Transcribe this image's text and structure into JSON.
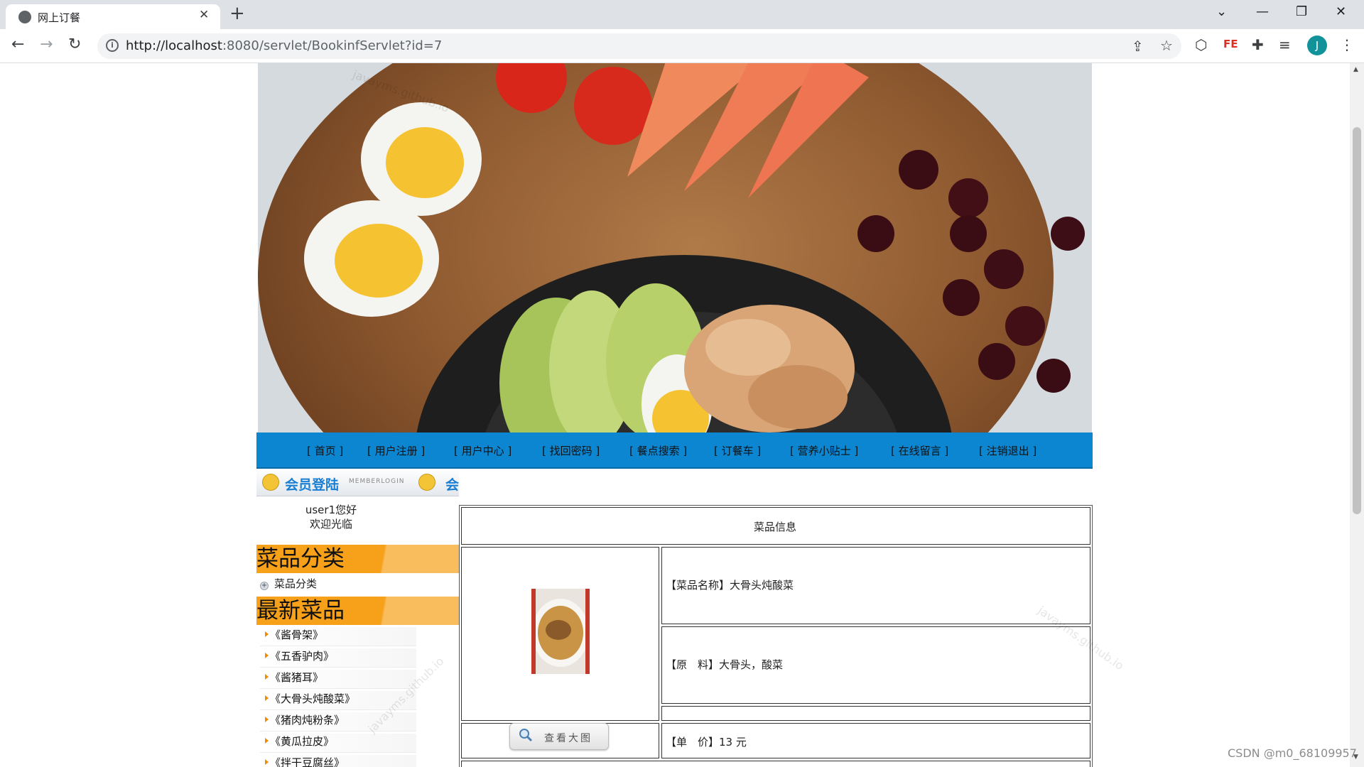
{
  "browser": {
    "tab_title": "网上订餐",
    "url_host": "http://localhost",
    "url_rest": ":8080/servlet/BookinfServlet?id=7",
    "profile_initial": "J"
  },
  "nav": {
    "items": [
      "[ 首页 ]",
      "[ 用户注册 ]",
      "[ 用户中心 ]",
      "[ 找回密码 ]",
      "[ 餐点搜索 ]",
      "[ 订餐车 ]",
      "[ 营养小贴士 ]",
      "[ 在线留言 ]",
      "[ 注销退出 ]"
    ]
  },
  "sidebar": {
    "member_title": "会员登陆",
    "member_subtitle": "MEMBERLOGIN",
    "member_more": "会",
    "greeting_line1": "user1您好",
    "greeting_line2": "欢迎光临",
    "category_heading": "菜品分类",
    "category_link": "菜品分类",
    "latest_heading": "最新菜品",
    "latest_items": [
      "《酱骨架》",
      "《五香驴肉》",
      "《酱猪耳》",
      "《大骨头炖酸菜》",
      "《猪肉炖粉条》",
      "《黄瓜拉皮》",
      "《拌干豆腐丝》"
    ]
  },
  "dish_info": {
    "header": "菜品信息",
    "name_row": "【菜品名称】大骨头炖酸菜",
    "ingredients_row": "【原　料】大骨头，酸菜",
    "price_row": "【单　价】13 元",
    "view_big_button": "查看大图"
  },
  "watermarks": {
    "site": "javayms.github.io",
    "csdn": "CSDN @m0_68109957"
  },
  "colors": {
    "nav_bar": "#0d86d1",
    "category_orange": "#f7a11a",
    "member_blue": "#1a7fd3"
  }
}
